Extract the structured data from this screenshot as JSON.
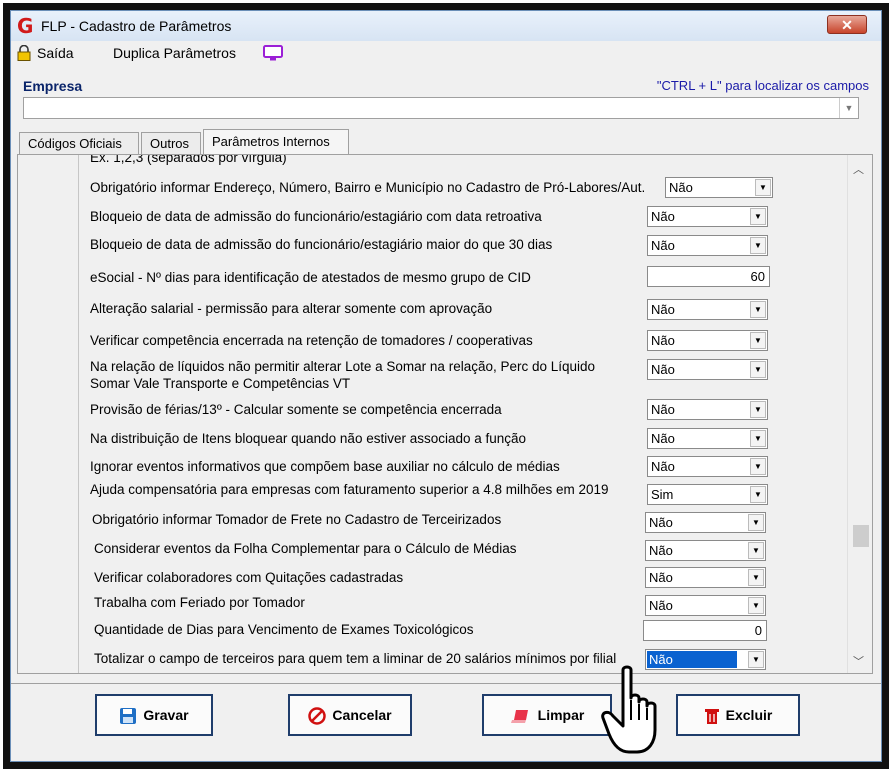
{
  "window": {
    "title": "FLP - Cadastro de Parâmetros",
    "close_glyph": "✕"
  },
  "menu": {
    "saida": "Saída",
    "duplica": "Duplica Parâmetros",
    "icons": [
      "lock-icon",
      "monitor-icon"
    ]
  },
  "empresa": {
    "label": "Empresa",
    "hint": "\"CTRL + L\" para localizar os campos",
    "value": ""
  },
  "tabs": [
    {
      "label": "Códigos Oficiais"
    },
    {
      "label": "Outros"
    },
    {
      "label": "Parâmetros Internos",
      "active": true
    }
  ],
  "rows": [
    {
      "label": "Ex. 1,2,3 (separados por vírgula)"
    },
    {
      "label": "Obrigatório informar Endereço, Número, Bairro e Município no Cadastro de Pró-Labores/Aut.",
      "value": "Não"
    },
    {
      "label": "Bloqueio de data de admissão do funcionário/estagiário com data retroativa",
      "value": "Não"
    },
    {
      "label": "Bloqueio de data de admissão do funcionário/estagiário maior do que 30 dias",
      "value": "Não"
    },
    {
      "label": "eSocial - Nº dias para identificação de atestados de mesmo grupo de CID",
      "value": "60"
    },
    {
      "label": "Alteração salarial - permissão para alterar somente com aprovação",
      "value": "Não"
    },
    {
      "label": "Verificar competência encerrada na retenção de tomadores / cooperativas",
      "value": "Não"
    },
    {
      "label": "Na relação de líquidos não permitir alterar Lote a Somar na relação, Perc do Líquido",
      "label2": "Somar Vale Transporte e  Competências VT",
      "value": "Não"
    },
    {
      "label": "Provisão de férias/13º - Calcular somente se competência encerrada",
      "value": "Não"
    },
    {
      "label": "Na distribuição de Itens bloquear quando não estiver associado a função",
      "value": "Não"
    },
    {
      "label": "Ignorar eventos informativos que compõem base auxiliar no cálculo de médias",
      "value": "Não"
    },
    {
      "label": "Ajuda compensatória para empresas com faturamento superior a 4.8 milhões em 2019",
      "value": "Sim"
    },
    {
      "label": "Obrigatório informar Tomador de Frete no Cadastro de Terceirizados",
      "value": "Não"
    },
    {
      "label": "Considerar eventos da Folha Complementar para o Cálculo de Médias",
      "value": "Não"
    },
    {
      "label": "Verificar colaboradores com Quitações cadastradas",
      "value": "Não"
    },
    {
      "label": "Trabalha com Feriado por Tomador",
      "value": "Não"
    },
    {
      "label": "Quantidade de Dias para Vencimento de Exames Toxicológicos",
      "value": "0"
    },
    {
      "label": "Totalizar o campo de terceiros para quem tem a liminar de 20 salários mínimos por filial",
      "value": "Não"
    }
  ],
  "buttons": {
    "gravar": "Gravar",
    "cancelar": "Cancelar",
    "limpar": "Limpar",
    "excluir": "Excluir"
  },
  "colors": {
    "accent_blue": "#0a62d0",
    "title_red": "#d11a1a",
    "cancel_red": "#d01010",
    "save_blue": "#1f6fc5"
  }
}
